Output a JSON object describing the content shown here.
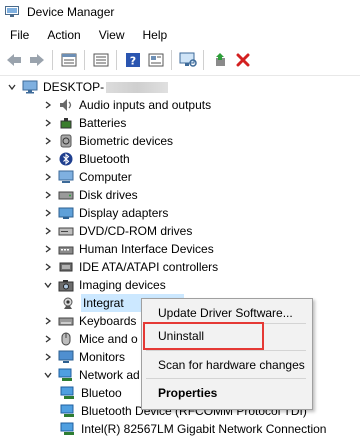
{
  "window": {
    "title": "Device Manager"
  },
  "menu": [
    "File",
    "Action",
    "View",
    "Help"
  ],
  "toolbar": {
    "buttons": [
      "back-icon",
      "forward-icon",
      "properties-icon",
      "help-icon",
      "update-icon",
      "scan-icon",
      "add-driver-icon",
      "uninstall-icon"
    ]
  },
  "tree": {
    "root": "DESKTOP-",
    "items": [
      {
        "label": "Audio inputs and outputs",
        "icon": "speaker-icon"
      },
      {
        "label": "Batteries",
        "icon": "battery-icon"
      },
      {
        "label": "Biometric devices",
        "icon": "biometric-icon"
      },
      {
        "label": "Bluetooth",
        "icon": "bluetooth-icon"
      },
      {
        "label": "Computer",
        "icon": "computer-icon"
      },
      {
        "label": "Disk drives",
        "icon": "disk-icon"
      },
      {
        "label": "Display adapters",
        "icon": "display-icon"
      },
      {
        "label": "DVD/CD-ROM drives",
        "icon": "dvd-icon"
      },
      {
        "label": "Human Interface Devices",
        "icon": "hid-icon"
      },
      {
        "label": "IDE ATA/ATAPI controllers",
        "icon": "ide-icon"
      },
      {
        "label": "Imaging devices",
        "icon": "camera-icon"
      },
      {
        "label": "Integrat",
        "icon": "webcam-icon"
      },
      {
        "label": "Keyboards",
        "icon": "keyboard-icon"
      },
      {
        "label": "Mice and o",
        "icon": "mouse-icon"
      },
      {
        "label": "Monitors",
        "icon": "monitor-icon"
      },
      {
        "label": "Network ad",
        "icon": "network-icon"
      },
      {
        "label": "Bluetoo",
        "icon": "network-adapter-icon"
      },
      {
        "label": "Bluetooth Device (RFCOMM Protocol TDI)",
        "icon": "network-adapter-icon"
      },
      {
        "label": "Intel(R) 82567LM Gigabit Network Connection",
        "icon": "network-adapter-icon"
      }
    ]
  },
  "context_menu": {
    "update": "Update Driver Software...",
    "uninstall": "Uninstall",
    "scan": "Scan for hardware changes",
    "properties": "Properties"
  },
  "colors": {
    "highlight": "#e53935",
    "selection": "#cce8ff"
  }
}
